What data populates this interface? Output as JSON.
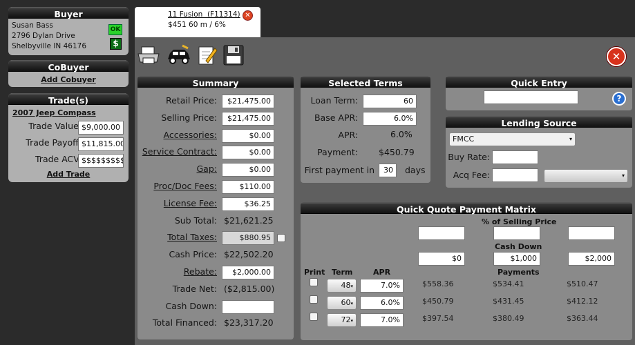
{
  "buyer": {
    "title": "Buyer",
    "name": "Susan Bass",
    "address1": "2796 Dylan Drive",
    "address2": "Shelbyville IN 46176",
    "ok_badge": "OK",
    "dollar_badge": "$"
  },
  "cobuyer": {
    "title": "CoBuyer",
    "add_link": "Add Cobuyer"
  },
  "trades": {
    "title": "Trade(s)",
    "vehicle": "2007 Jeep Compass",
    "value_label": "Trade Value:",
    "value": "$9,000.00",
    "payoff_label": "Trade Payoff:",
    "payoff": "$11,815.00",
    "acv_label": "Trade ACV:",
    "acv": "$$$$$$$$$",
    "add_link": "Add Trade"
  },
  "tab": {
    "title": "11 Fusion  (F11314)",
    "subtitle": "$451 60 m / 6%"
  },
  "toolbar": {
    "icons": [
      "printer-icon",
      "car-icon",
      "notepad-icon",
      "save-icon"
    ]
  },
  "summary": {
    "title": "Summary",
    "rows": [
      {
        "label": "Retail Price:",
        "value": "$21,475.00",
        "kind": "input"
      },
      {
        "label": "Selling Price:",
        "value": "$21,475.00",
        "kind": "input"
      },
      {
        "label": "Accessories:",
        "value": "$0.00",
        "kind": "input",
        "link": true
      },
      {
        "label": "Service Contract:",
        "value": "$0.00",
        "kind": "input",
        "link": true
      },
      {
        "label": "Gap:",
        "value": "$0.00",
        "kind": "input",
        "link": true
      },
      {
        "label": "Proc/Doc Fees:",
        "value": "$110.00",
        "kind": "input",
        "link": true
      },
      {
        "label": "License Fee:",
        "value": "$36.25",
        "kind": "input",
        "link": true
      },
      {
        "label": "Sub Total:",
        "value": "$21,621.25",
        "kind": "text"
      },
      {
        "label": "Total Taxes:",
        "value": "$880.95",
        "kind": "gray",
        "link": true
      },
      {
        "label": "Cash Price:",
        "value": "$22,502.20",
        "kind": "text"
      },
      {
        "label": "Rebate:",
        "value": "$2,000.00",
        "kind": "input",
        "link": true
      },
      {
        "label": "Trade Net:",
        "value": "($2,815.00)",
        "kind": "text"
      },
      {
        "label": "Cash Down:",
        "value": "",
        "kind": "input"
      },
      {
        "label": "Total Financed:",
        "value": "$23,317.20",
        "kind": "text"
      }
    ]
  },
  "terms": {
    "title": "Selected Terms",
    "loan_term_label": "Loan Term:",
    "loan_term": "60",
    "base_apr_label": "Base APR:",
    "base_apr": "6.0%",
    "apr_label": "APR:",
    "apr": "6.0%",
    "payment_label": "Payment:",
    "payment": "$450.79",
    "first_payment_label": "First payment in",
    "first_payment_days": "30",
    "days_label": "days"
  },
  "quick_entry": {
    "title": "Quick Entry",
    "value": ""
  },
  "lending": {
    "title": "Lending Source",
    "source": "FMCC",
    "buy_rate_label": "Buy Rate:",
    "buy_rate": "",
    "acq_fee_label": "Acq Fee:",
    "acq_fee": "",
    "extra_select": ""
  },
  "matrix": {
    "title": "Quick Quote Payment Matrix",
    "pct_label": "% of Selling Price",
    "cash_down_label": "Cash Down",
    "payments_label": "Payments",
    "print_hdr": "Print",
    "term_hdr": "Term",
    "apr_hdr": "APR",
    "cash_downs": [
      "$0",
      "$1,000",
      "$2,000"
    ],
    "rows": [
      {
        "term": "48",
        "apr": "7.0%",
        "payments": [
          "$558.36",
          "$534.41",
          "$510.47"
        ]
      },
      {
        "term": "60",
        "apr": "6.0%",
        "payments": [
          "$450.79",
          "$431.45",
          "$412.12"
        ]
      },
      {
        "term": "72",
        "apr": "7.0%",
        "payments": [
          "$397.54",
          "$380.49",
          "$363.44"
        ]
      }
    ]
  }
}
